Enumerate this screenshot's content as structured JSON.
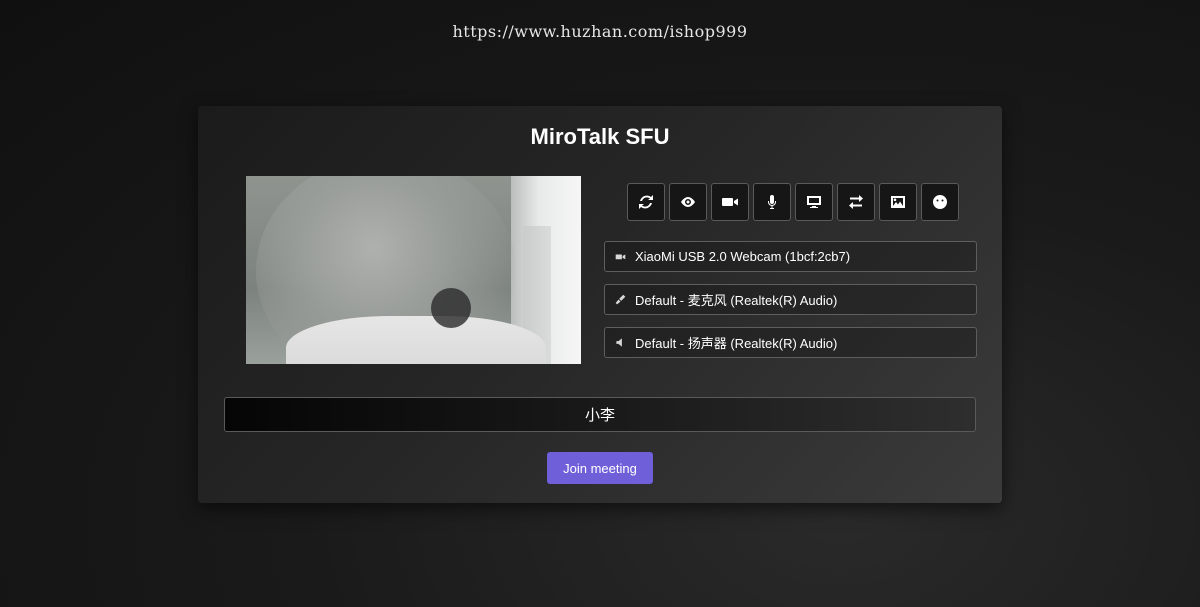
{
  "watermark": "https://www.huzhan.com/ishop999",
  "title": "MiroTalk SFU",
  "toolbar": {
    "buttons": [
      {
        "name": "refresh-icon"
      },
      {
        "name": "eye-icon"
      },
      {
        "name": "video-camera-icon"
      },
      {
        "name": "microphone-icon"
      },
      {
        "name": "desktop-icon"
      },
      {
        "name": "swap-icon"
      },
      {
        "name": "image-icon"
      },
      {
        "name": "smile-icon"
      }
    ]
  },
  "devices": {
    "video": "XiaoMi USB 2.0 Webcam (1bcf:2cb7)",
    "audio_in": "Default - 麦克风 (Realtek(R) Audio)",
    "audio_out": "Default - 扬声器 (Realtek(R) Audio)"
  },
  "name_input": {
    "value": "小李"
  },
  "join_label": "Join meeting",
  "colors": {
    "accent": "#6f5fd8",
    "card_bg": "#262626"
  }
}
